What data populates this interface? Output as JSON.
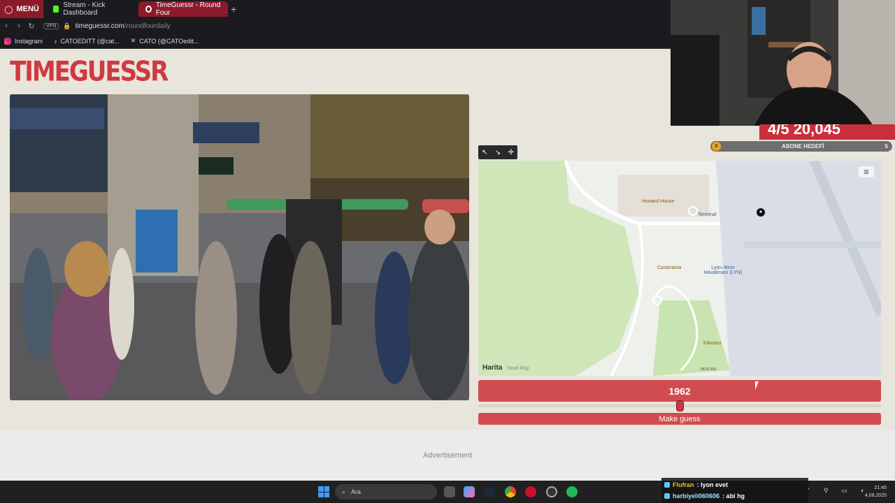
{
  "browser": {
    "menu_label": "MENÜ",
    "tabs": [
      {
        "label": "Stream - Kick Dashboard"
      },
      {
        "label": "TimeGuessr - Round Four"
      }
    ],
    "new_tab_symbol": "+",
    "vpn_label": "VPN",
    "url_host": "timeguessr.com",
    "url_path": "/roundfourdaily",
    "bookmarks": [
      {
        "label": "Instagram"
      },
      {
        "label": "CATOEDITT (@cat..."
      },
      {
        "label": "CATO (@CATOedit..."
      }
    ]
  },
  "game": {
    "logo": "TIMEGUESSR",
    "map": {
      "labels": {
        "howard_house": "Howard House",
        "terminal": "Terminal",
        "castorama": "Castorama",
        "airport": "Lyon–Bron Havalimanı (LYN)",
        "kiloutou": "Kiloutou",
        "road": "MERLING"
      },
      "attribution": "Harita",
      "legal": "Yasal Bilgi"
    },
    "year": "1962",
    "slider_fraction": 0.5,
    "guess_button": "Make guess",
    "advertisement": "Advertisement"
  },
  "overlay": {
    "score_text": "4/5 20,045",
    "goal_label": "ABONE HEDEFİ",
    "goal_current": "0",
    "goal_target": "5"
  },
  "taskbar": {
    "search_placeholder": "Ara",
    "time": "21:45",
    "date": "4.08.2025"
  },
  "chat": [
    {
      "user": "Flufran",
      "message": ": lyon evet"
    },
    {
      "user": "harbiyeli060606",
      "message": ": abi hg"
    }
  ],
  "colors": {
    "accent": "#d14c50",
    "logo": "#cf3940",
    "tab_active": "#8c1a2a"
  }
}
